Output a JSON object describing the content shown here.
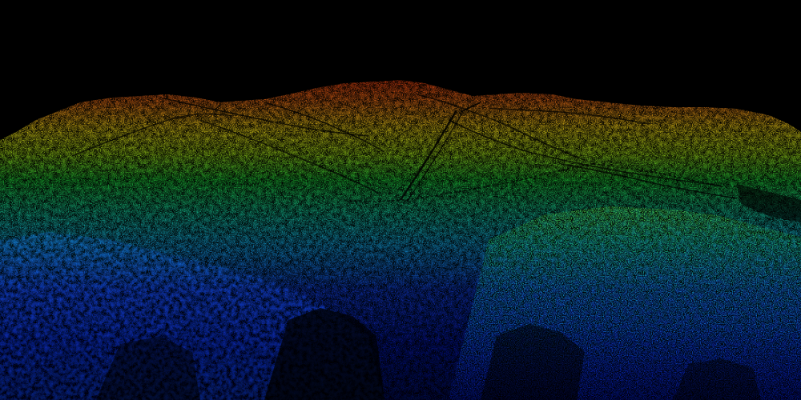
{
  "scene": {
    "kind": "lidar-point-cloud-terrain",
    "background_color": "#000000",
    "elevation_palette": [
      "#0a0f8a",
      "#1240e0",
      "#17a8e6",
      "#18d8b0",
      "#22d23a",
      "#a6e21c",
      "#f2e41a",
      "#f59a14",
      "#ef3a12"
    ],
    "features": [
      "mountain-ridge",
      "valley",
      "power-line-corridor",
      "dirt-road"
    ]
  }
}
